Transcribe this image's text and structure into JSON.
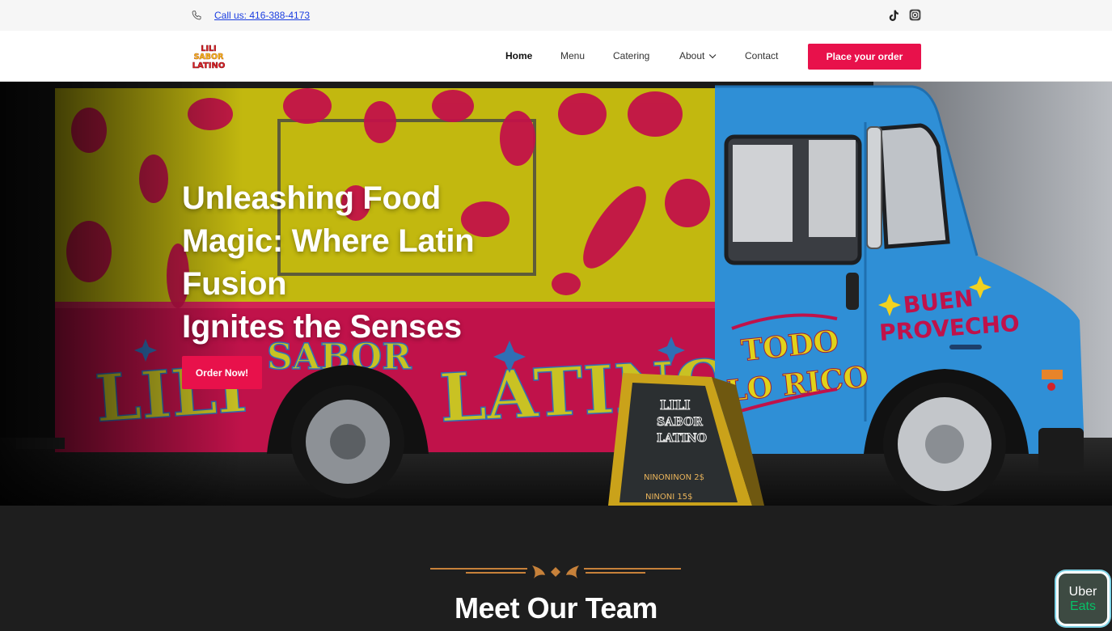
{
  "topbar": {
    "phone_icon": "phone-icon",
    "phone_text": "Call us: 416-388-4173",
    "social": [
      "tiktok-icon",
      "instagram-icon"
    ]
  },
  "brand": {
    "logo_lines": [
      "LILI",
      "SABOR",
      "LATINO"
    ]
  },
  "nav": {
    "items": [
      {
        "label": "Home",
        "active": true
      },
      {
        "label": "Menu"
      },
      {
        "label": "Catering"
      },
      {
        "label": "About",
        "has_dropdown": true
      },
      {
        "label": "Contact"
      }
    ],
    "cta": "Place your order"
  },
  "hero": {
    "title_lines": [
      "Unleashing Food",
      "Magic: Where Latin",
      "Fusion",
      "Ignites the Senses"
    ],
    "button": "Order Now!",
    "truck_text": {
      "side": "LILI SABOR LATINO",
      "door": "TODO LO RICO",
      "cab": "BUEN PROVECHO",
      "sign_top": "LILI SABOR LATINO",
      "sign_line1": "NINONINON 2$",
      "sign_line2": "NINONI 15$"
    }
  },
  "team": {
    "title": "Meet Our Team"
  },
  "uber_badge": {
    "line1": "Uber",
    "line2": "Eats"
  },
  "colors": {
    "accent": "#e8114b",
    "dark_bg": "#1e1e1e",
    "truck_blue": "#2f8fd6",
    "truck_yellow": "#c9be10",
    "truck_red": "#c5144a",
    "ornament": "#c7813a"
  }
}
